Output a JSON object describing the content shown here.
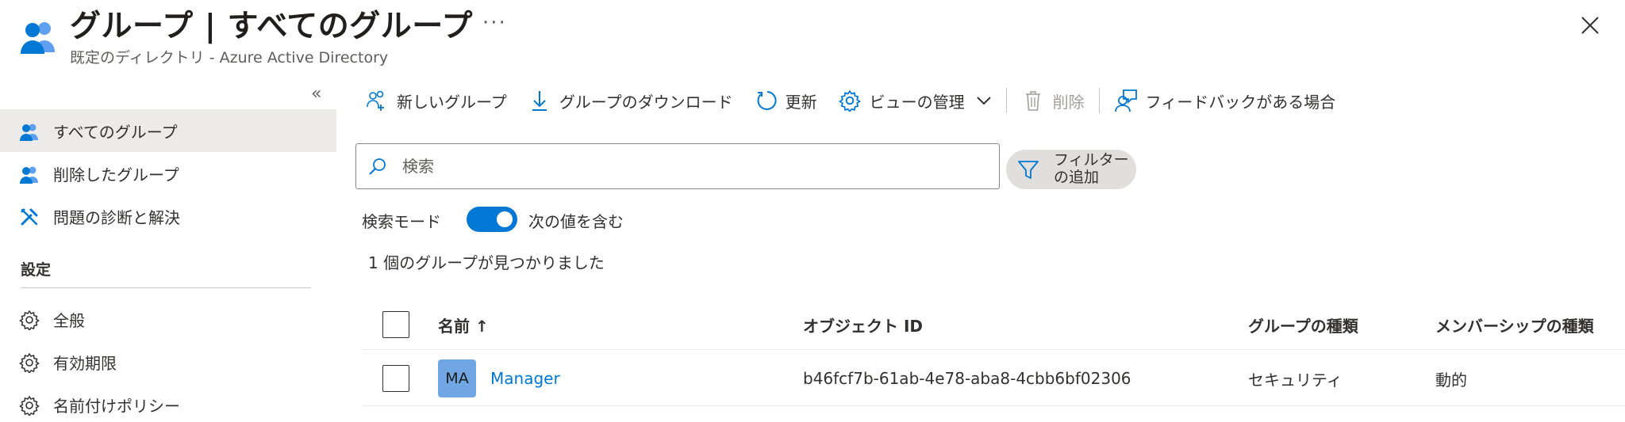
{
  "header": {
    "title": "グループ | すべてのグループ",
    "more": "···",
    "subtitle": "既定のディレクトリ - Azure Active Directory",
    "icon": "users-group-icon",
    "close_icon": "close-icon"
  },
  "sidebar": {
    "collapse_label": "«",
    "items": [
      {
        "label": "すべてのグループ",
        "icon": "users-group-icon",
        "active": true
      },
      {
        "label": "削除したグループ",
        "icon": "users-group-icon",
        "active": false
      },
      {
        "label": "問題の診断と解決",
        "icon": "wrench-icon",
        "active": false
      }
    ],
    "settings_header": "設定",
    "settings_items": [
      {
        "label": "全般",
        "icon": "gear-icon"
      },
      {
        "label": "有効期限",
        "icon": "gear-icon"
      },
      {
        "label": "名前付けポリシー",
        "icon": "gear-icon"
      }
    ]
  },
  "toolbar": {
    "new_group": "新しいグループ",
    "download": "グループのダウンロード",
    "refresh": "更新",
    "manage_view": "ビューの管理",
    "delete": "削除",
    "feedback": "フィードバックがある場合"
  },
  "search": {
    "placeholder": "検索",
    "value": ""
  },
  "filter": {
    "label": "フィルターの追加"
  },
  "search_mode": {
    "label": "検索モード",
    "toggle_on": true,
    "toggle_text": "次の値を含む"
  },
  "results": {
    "count_text": "1 個のグループが見つかりました"
  },
  "table": {
    "columns": [
      "名前 ↑",
      "オブジェクト ID",
      "グループの種類",
      "メンバーシップの種類"
    ],
    "rows": [
      {
        "avatar": "MA",
        "name": "Manager",
        "object_id": "b46fcf7b-61ab-4e78-aba8-4cbb6bf02306",
        "group_type": "セキュリティ",
        "membership_type": "動的"
      }
    ]
  },
  "colors": {
    "accent": "#0078d4",
    "active_nav_bg": "#edebe9",
    "avatar_bg": "#6fa6e3"
  }
}
